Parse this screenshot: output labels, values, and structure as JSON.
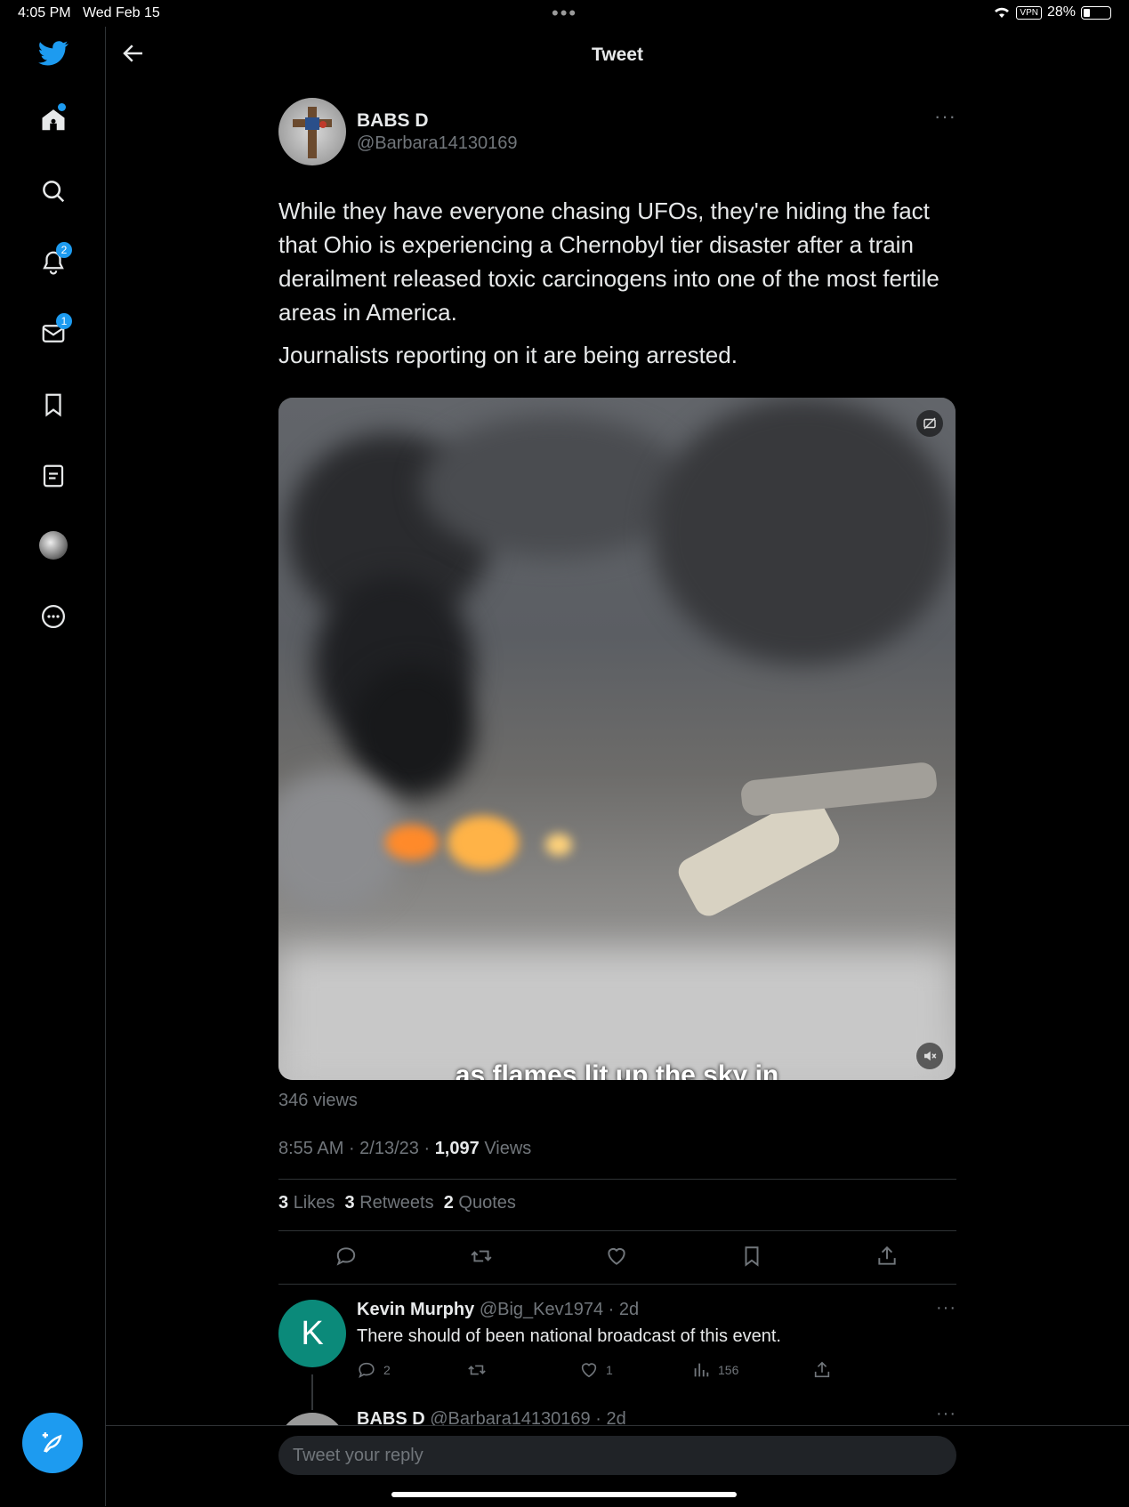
{
  "status_bar": {
    "time": "4:05 PM",
    "date": "Wed Feb 15",
    "vpn": "VPN",
    "battery": "28%",
    "battery_level": 0.28
  },
  "sidebar": {
    "badges": {
      "notifications": "2",
      "messages": "1"
    }
  },
  "header": {
    "title": "Tweet"
  },
  "tweet": {
    "author_name": "BABS D",
    "author_handle": "@Barbara14130169",
    "more": "···",
    "paragraph1": "While they have everyone chasing UFOs, they're hiding the fact that Ohio is experiencing a Chernobyl tier disaster after a train derailment released toxic carcinogens into one of the most fertile areas in America.",
    "paragraph2": "Journalists reporting on it are being arrested.",
    "video_caption": "as flames lit up the sky in",
    "video_views": "346 views",
    "time": "8:55 AM",
    "date": "2/13/23",
    "views_count": "1,097",
    "views_label": "Views",
    "likes_count": "3",
    "likes_label": "Likes",
    "retweets_count": "3",
    "retweets_label": "Retweets",
    "quotes_count": "2",
    "quotes_label": "Quotes"
  },
  "replies": [
    {
      "avatar_letter": "K",
      "name": "Kevin Murphy",
      "handle_time": "@Big_Kev1974 · 2d",
      "text": "There should of been national broadcast of this event.",
      "replies": "2",
      "likes": "1",
      "views": "156",
      "more": "···"
    },
    {
      "name": "BABS D",
      "handle_time": "@Barbara14130169 · 2d",
      "more": "···"
    }
  ],
  "reply_box": {
    "placeholder": "Tweet your reply"
  },
  "colors": {
    "accent": "#1d9bf0",
    "background": "#000000",
    "text": "#e7e9ea",
    "muted": "#71767b"
  }
}
